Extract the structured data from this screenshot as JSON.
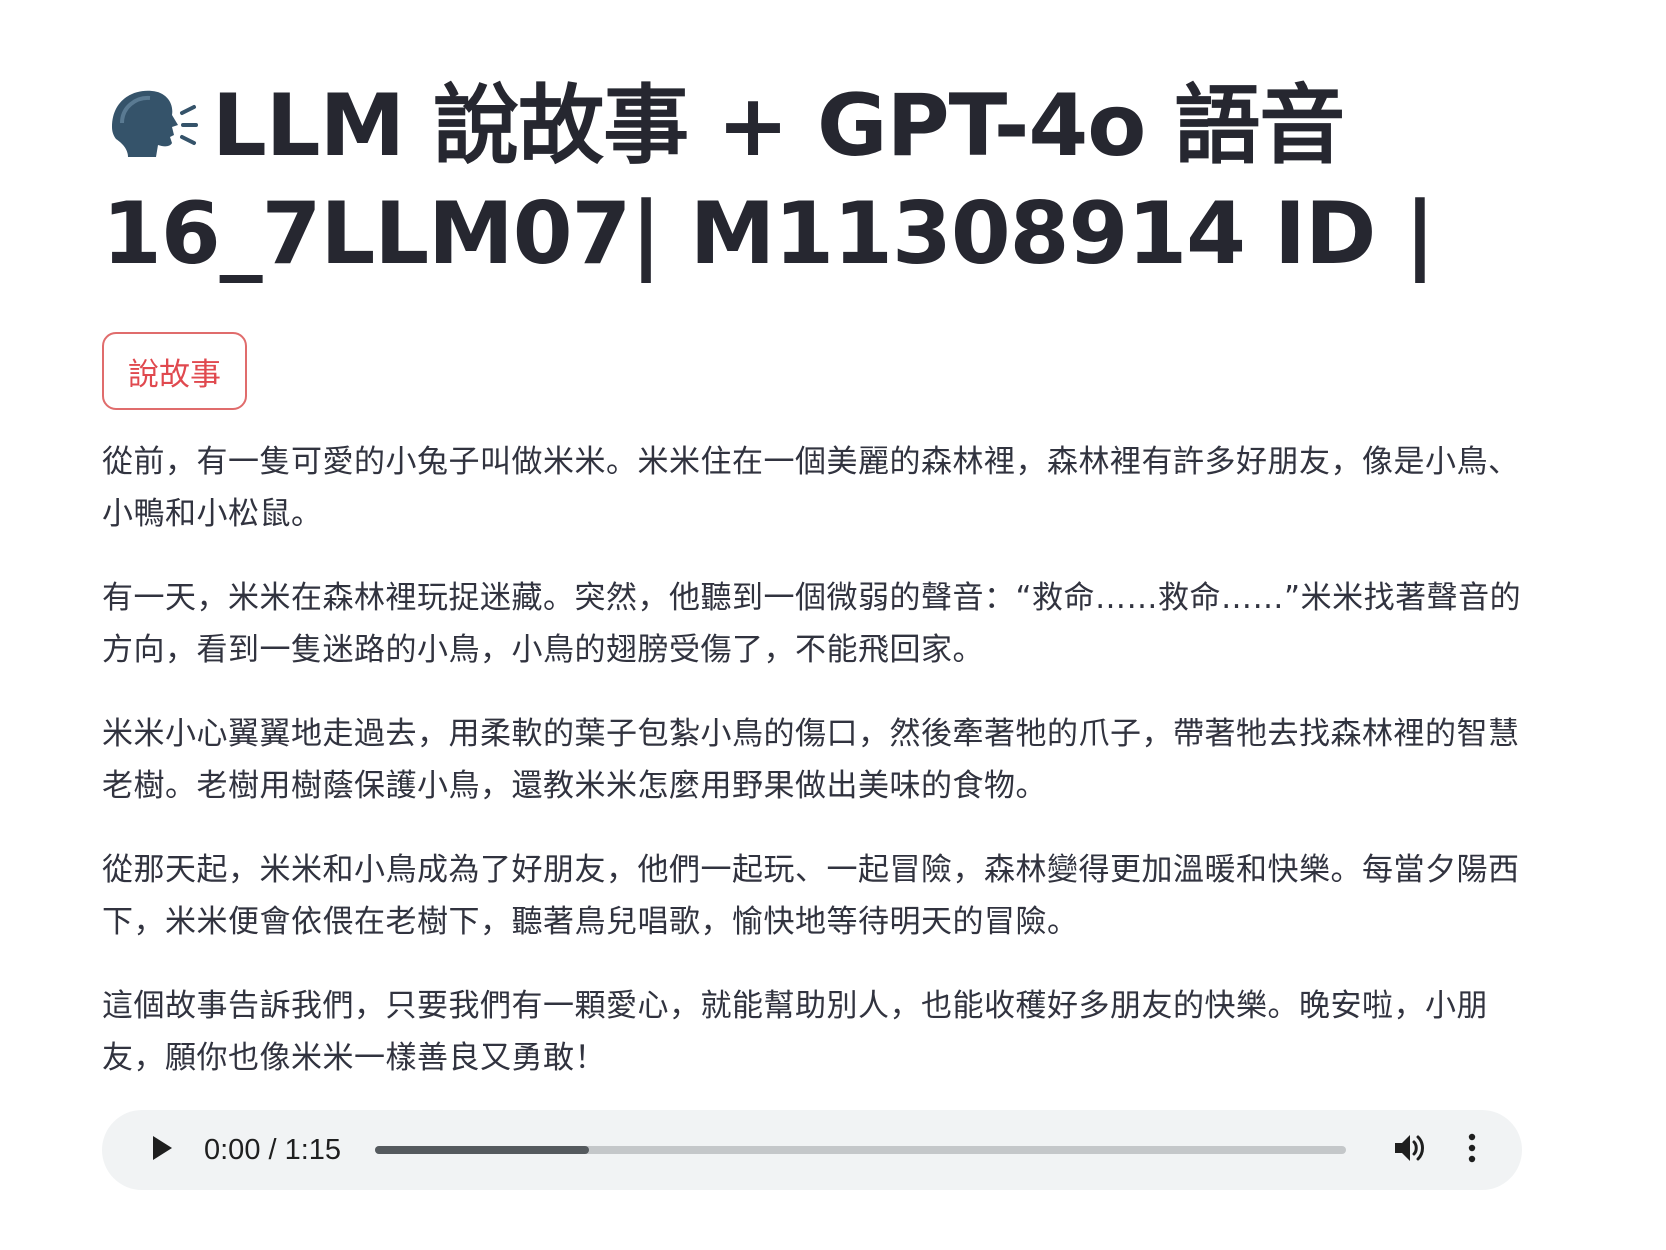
{
  "header": {
    "title_line1": "LLM 說故事 + GPT-4o 語音",
    "title_line2": "16_7LLM07| M11308914 ID |",
    "title_icon": "speaking-head-icon"
  },
  "tag_button": {
    "label": "說故事"
  },
  "story": {
    "paragraphs": [
      "從前，有一隻可愛的小兔子叫做米米。米米住在一個美麗的森林裡，森林裡有許多好朋友，像是小鳥、小鴨和小松鼠。",
      "有一天，米米在森林裡玩捉迷藏。突然，他聽到一個微弱的聲音：“救命……救命……”米米找著聲音的方向，看到一隻迷路的小鳥，小鳥的翅膀受傷了，不能飛回家。",
      "米米小心翼翼地走過去，用柔軟的葉子包紮小鳥的傷口，然後牽著牠的爪子，帶著牠去找森林裡的智慧老樹。老樹用樹蔭保護小鳥，還教米米怎麼用野果做出美味的食物。",
      "從那天起，米米和小鳥成為了好朋友，他們一起玩、一起冒險，森林變得更加溫暖和快樂。每當夕陽西下，米米便會依偎在老樹下，聽著鳥兒唱歌，愉快地等待明天的冒險。",
      "這個故事告訴我們，只要我們有一顆愛心，就能幫助別人，也能收穫好多朋友的快樂。晚安啦，小朋友，願你也像米米一樣善良又勇敢！"
    ]
  },
  "audio": {
    "time_display": "0:00 / 1:15",
    "buffered_fraction": 0.22,
    "icons": {
      "play": "play-icon",
      "volume": "volume-icon",
      "more": "more-vertical-icon"
    }
  },
  "colors": {
    "accent": "#e0494f",
    "text": "#31333f",
    "player_bg": "#f1f3f4"
  }
}
